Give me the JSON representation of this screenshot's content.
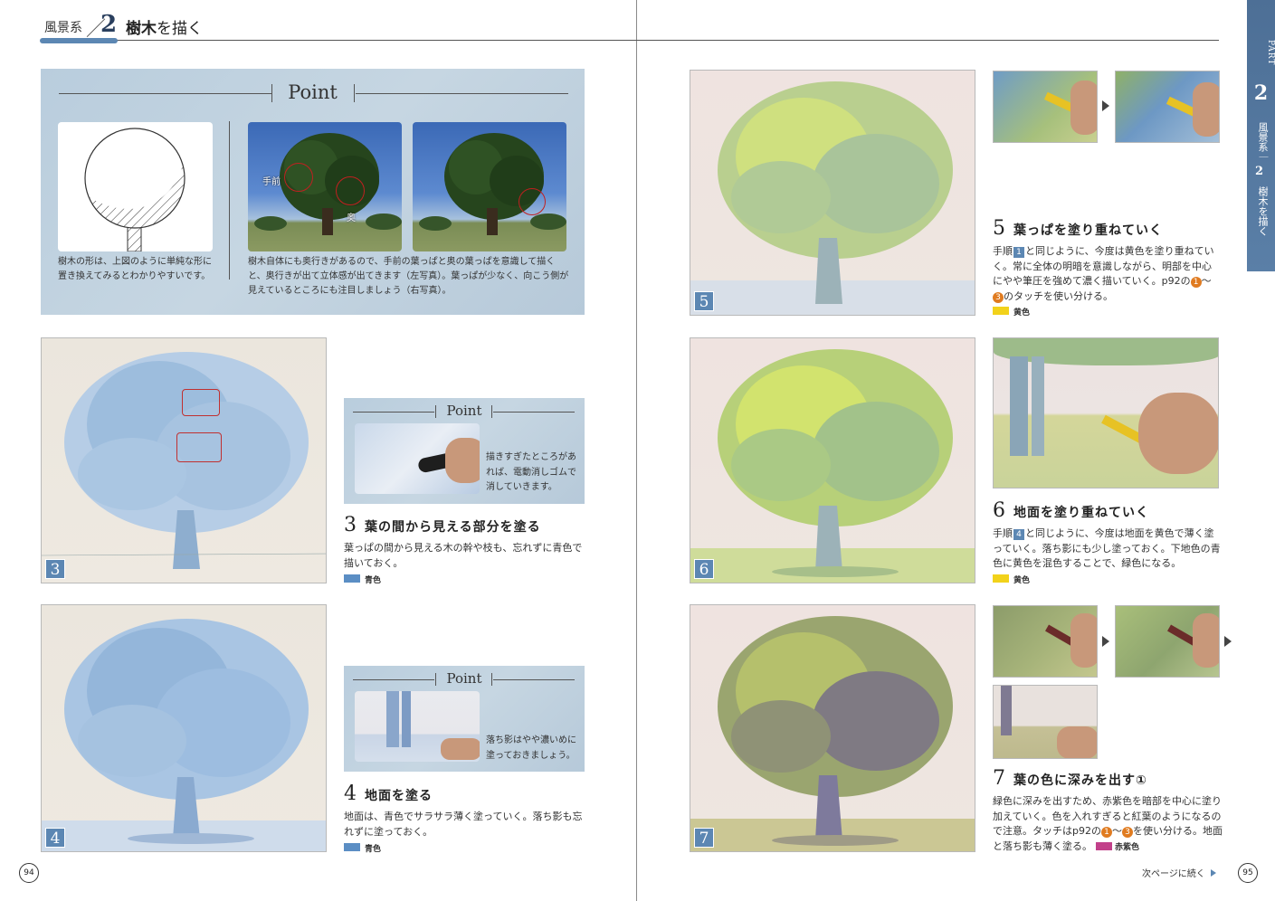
{
  "header": {
    "category": "風景系",
    "slash_num": "2",
    "title": "樹木",
    "title_suffix": "を描く"
  },
  "sidebar": {
    "part_label": "PART",
    "part_num": "2",
    "vertical_text_1": "風景系",
    "vertical_dash": "｜",
    "vertical_num": "2",
    "vertical_text_2": "樹木を描く"
  },
  "top_point": {
    "heading": "Point",
    "label_near": "手前",
    "label_far": "奥",
    "text_left": "樹木の形は、上図のように単純な形に置き換えてみるとわかりやすいです。",
    "text_right": "樹木自体にも奥行きがあるので、手前の葉っぱと奥の葉っぱを意識して描くと、奥行きが出て立体感が出てきます（左写真）。葉っぱが少なく、向こう側が見えているところにも注目しましょう（右写真）。"
  },
  "steps": [
    {
      "num": "3",
      "title": "葉の間から見える部分を塗る",
      "text": "葉っぱの間から見える木の幹や枝も、忘れずに青色で描いておく。",
      "color_name": "青色",
      "color": "#5b8ec4"
    },
    {
      "num": "4",
      "title": "地面を塗る",
      "text": "地面は、青色でサラサラ薄く塗っていく。落ち影も忘れずに塗っておく。",
      "color_name": "青色",
      "color": "#5b8ec4"
    },
    {
      "num": "5",
      "title": "葉っぱを塗り重ねていく",
      "text_a": "手順",
      "ref": "1",
      "text_b": "と同じように、今度は黄色を塗り重ねていく。常に全体の明暗を意識しながら、明部を中心にやや筆圧を強めて濃く描いていく。p92の",
      "c1": "1",
      "tilde": "〜",
      "c2": "3",
      "text_c": "のタッチを使い分ける。",
      "color_name": "黄色",
      "color": "#f2d21b"
    },
    {
      "num": "6",
      "title": "地面を塗り重ねていく",
      "text_a": "手順",
      "ref": "4",
      "text_b": "と同じように、今度は地面を黄色で薄く塗っていく。落ち影にも少し塗っておく。下地色の青色に黄色を混色することで、緑色になる。",
      "color_name": "黄色",
      "color": "#f2d21b"
    },
    {
      "num": "7",
      "title": "葉の色に深みを出す①",
      "text_a": "緑色に深みを出すため、赤紫色を暗部を中心に塗り加えていく。色を入れすぎると紅葉のようになるので注意。タッチはp92の",
      "c1": "1",
      "tilde": "〜",
      "c2": "3",
      "text_c": "を使い分ける。地面と落ち影も薄く塗る。",
      "color_name": "赤紫色",
      "color": "#c2408a"
    }
  ],
  "point3": {
    "heading": "Point",
    "text": "描きすぎたところがあれば、電動消しゴムで消していきます。"
  },
  "point4": {
    "heading": "Point",
    "text": "落ち影はやや濃いめに塗っておきましょう。"
  },
  "footer": {
    "page_left": "94",
    "page_right": "95",
    "next": "次ページに続く"
  }
}
